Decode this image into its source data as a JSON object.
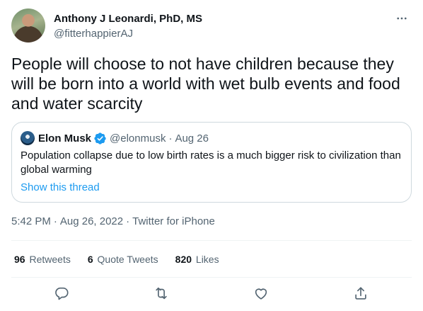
{
  "author": {
    "display_name": "Anthony J Leonardi, PhD, MS",
    "handle": "@fitterhappierAJ"
  },
  "tweet": {
    "text": "People will choose to not have children because they will be born into a world with wet bulb events and food and water scarcity",
    "time": "5:42 PM",
    "date": "Aug 26, 2022",
    "source": "Twitter for iPhone",
    "separator": "·"
  },
  "quoted": {
    "name": "Elon Musk",
    "handle": "@elonmusk",
    "date": "Aug 26",
    "separator": "·",
    "text": "Population collapse due to low birth rates is a much bigger risk to civilization than global warming",
    "link_label": "Show this thread"
  },
  "stats": [
    {
      "num": "96",
      "label": "Retweets"
    },
    {
      "num": "6",
      "label": "Quote Tweets"
    },
    {
      "num": "820",
      "label": "Likes"
    }
  ],
  "icons": {
    "more": "more-horizontal-icon",
    "verified": "verified-badge-icon",
    "reply": "reply-icon",
    "retweet": "retweet-icon",
    "like": "like-icon",
    "share": "share-icon"
  },
  "colors": {
    "text": "#0f1419",
    "secondary": "#536471",
    "link": "#1d9bf0",
    "border": "#cfd9de"
  }
}
